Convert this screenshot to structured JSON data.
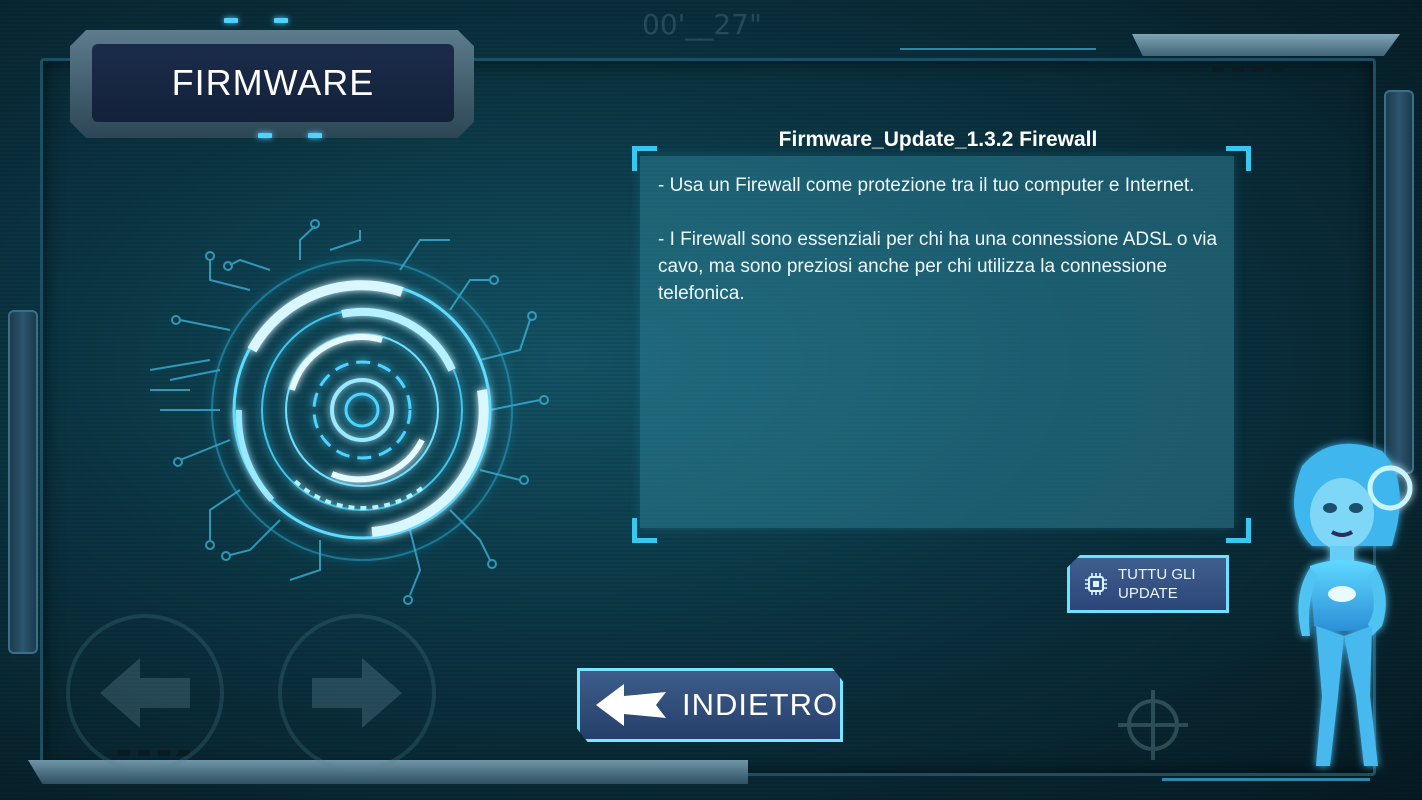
{
  "header": {
    "title": "FIRMWARE"
  },
  "background": {
    "timer_text": "00'__27\""
  },
  "panel": {
    "title": "Firmware_Update_1.3.2 Firewall",
    "paragraphs": [
      "- Usa un Firewall come protezione tra il tuo computer e Internet.",
      "- I Firewall sono essenziali per chi ha una connessione ADSL o via cavo, ma sono preziosi anche per chi utilizza la connessione telefonica."
    ]
  },
  "buttons": {
    "all_updates": "TUTTU GLI UPDATE",
    "back": "INDIETRO"
  },
  "icons": {
    "title_icon": "none",
    "all_updates_icon": "chip-icon",
    "back_icon": "back-arrow-icon",
    "nav_left": "arrow-left-icon",
    "nav_right": "arrow-right-icon",
    "target": "crosshair-icon"
  },
  "colors": {
    "accent": "#36c8f0",
    "button_fill": "#2c467a",
    "panel_fill": "#2b8096",
    "glow": "#7be6ff"
  }
}
